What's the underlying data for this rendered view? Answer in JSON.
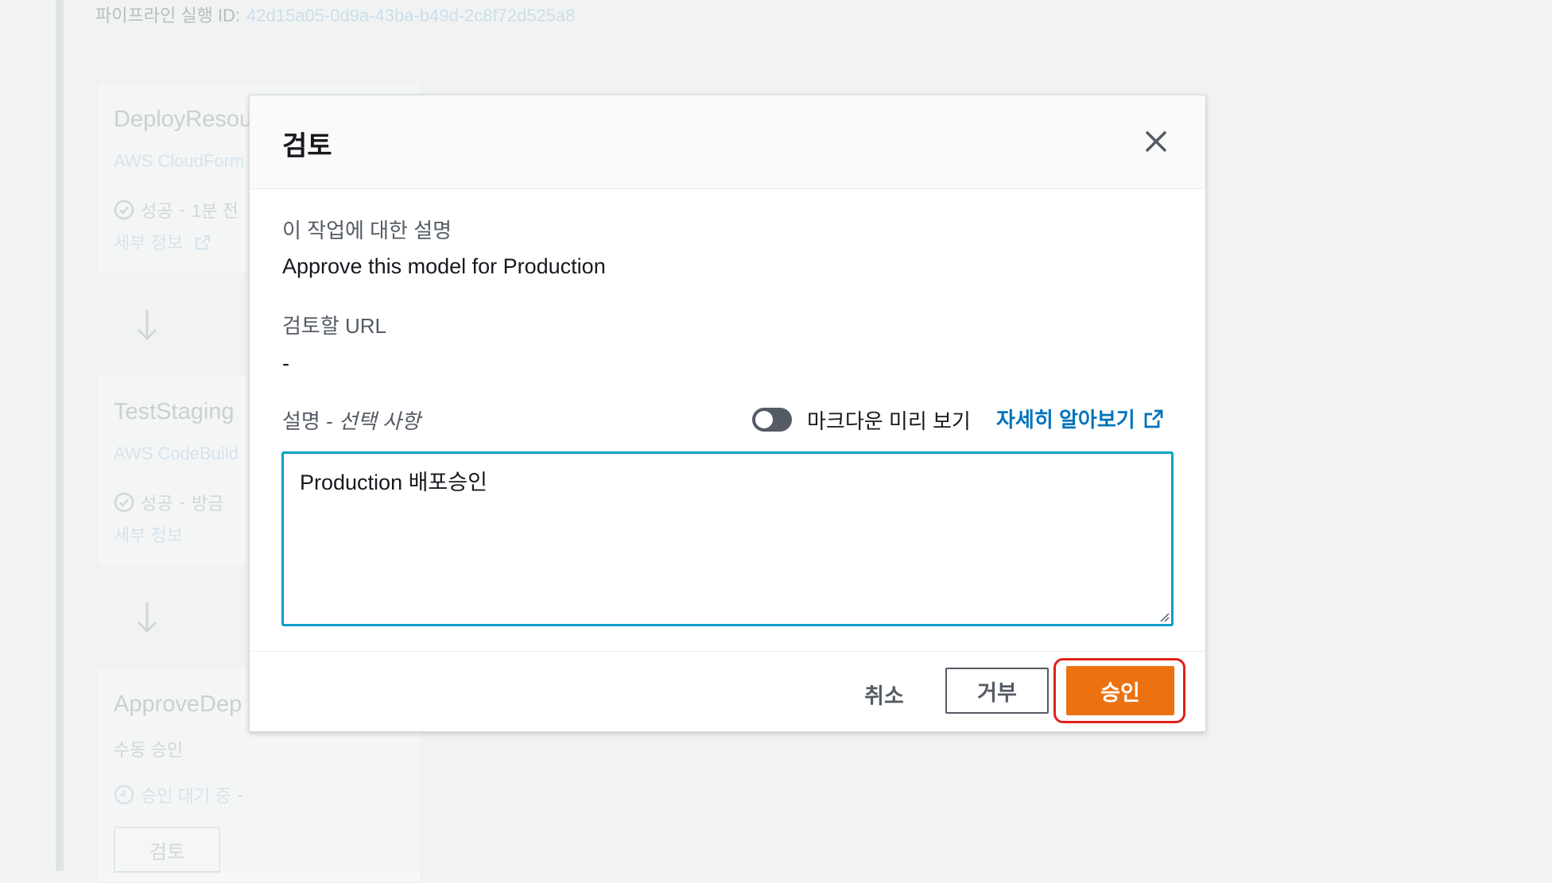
{
  "background": {
    "pipeline_id_label": "파이프라인 실행 ID:",
    "pipeline_id_value": "42d15a05-0d9a-43ba-b49d-2c8f72d525a8",
    "stages": [
      {
        "title": "DeployResou",
        "provider": "AWS CloudForm",
        "status": "성공",
        "time": "1분 전",
        "details": "세부 정보"
      },
      {
        "title": "TestStaging",
        "provider": "AWS CodeBuild",
        "status": "성공",
        "time": "방금",
        "details": "세부 정보"
      },
      {
        "title": "ApproveDep",
        "provider": "수동 승인",
        "status": "승인 대기 중",
        "time": "",
        "review_button": "검토"
      }
    ]
  },
  "modal": {
    "title": "검토",
    "close_icon": "close-icon",
    "description_label": "이 작업에 대한 설명",
    "description_value": "Approve this model for Production",
    "url_label": "검토할 URL",
    "url_value": "-",
    "comment_label": "설명 - ",
    "comment_optional": "선택 사항",
    "markdown_toggle_label": "마크다운 미리 보기",
    "markdown_toggle_on": false,
    "learn_more": "자세히 알아보기",
    "comment_value": "Production 배포승인",
    "buttons": {
      "cancel": "취소",
      "reject": "거부",
      "approve": "승인"
    }
  },
  "colors": {
    "accent_orange": "#ec7211",
    "link_blue": "#0073bb",
    "focus_cyan": "#00a1c9",
    "highlight_red": "#e0201b"
  }
}
